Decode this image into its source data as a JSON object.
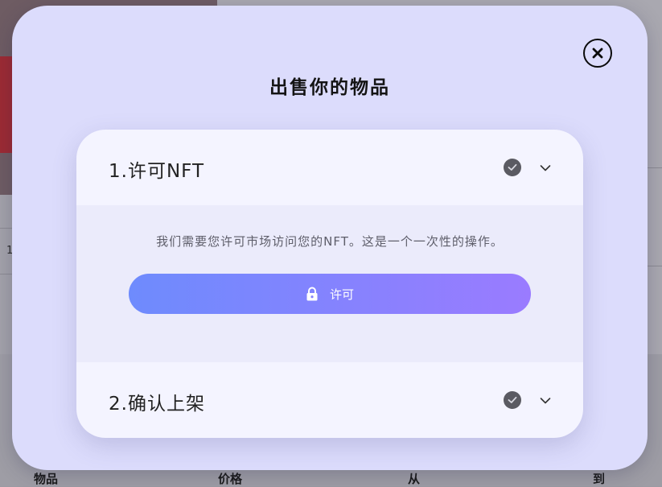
{
  "modal": {
    "title": "出售你的物品",
    "close_icon": "close-icon"
  },
  "steps": [
    {
      "title": "1.许可NFT",
      "description": "我们需要您许可市场访问您的NFT。这是一个一次性的操作。",
      "button_label": "许可",
      "button_icon": "lock-icon"
    },
    {
      "title": "2.确认上架"
    }
  ],
  "background": {
    "left_text": "1",
    "table_headers": [
      "物品",
      "价格",
      "从",
      "到"
    ]
  },
  "colors": {
    "modal_bg": "#dcdcfc",
    "card_bg": "#f4f4ff",
    "button_gradient_start": "#6e8bfd",
    "button_gradient_end": "#9a7bff",
    "check_fill": "#5a5a62"
  }
}
